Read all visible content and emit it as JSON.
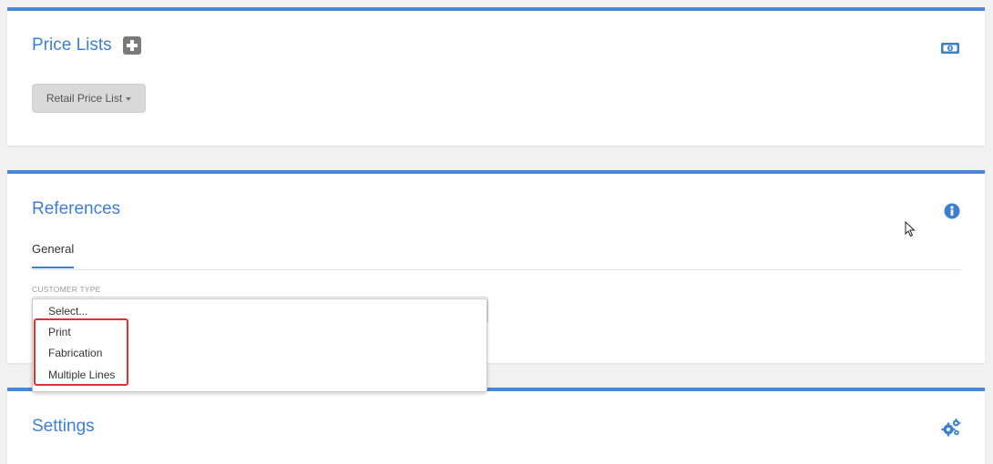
{
  "price_lists": {
    "title": "Price Lists",
    "dropdown_label": "Retail Price List",
    "icons": {
      "add": "plus-square-icon",
      "money": "money-bill-icon"
    }
  },
  "references": {
    "title": "References",
    "tab_label": "General",
    "field_label": "CUSTOMER TYPE",
    "options": [
      "Select...",
      "Print",
      "Fabrication",
      "Multiple Lines"
    ],
    "icons": {
      "info": "info-circle-icon"
    }
  },
  "settings": {
    "title": "Settings",
    "icons": {
      "gears": "gears-icon"
    }
  },
  "colors": {
    "accent": "#4a86d6",
    "title_blue": "#3d7fd0",
    "highlight_red": "#e03030",
    "button_gray": "#d9d9d9"
  }
}
